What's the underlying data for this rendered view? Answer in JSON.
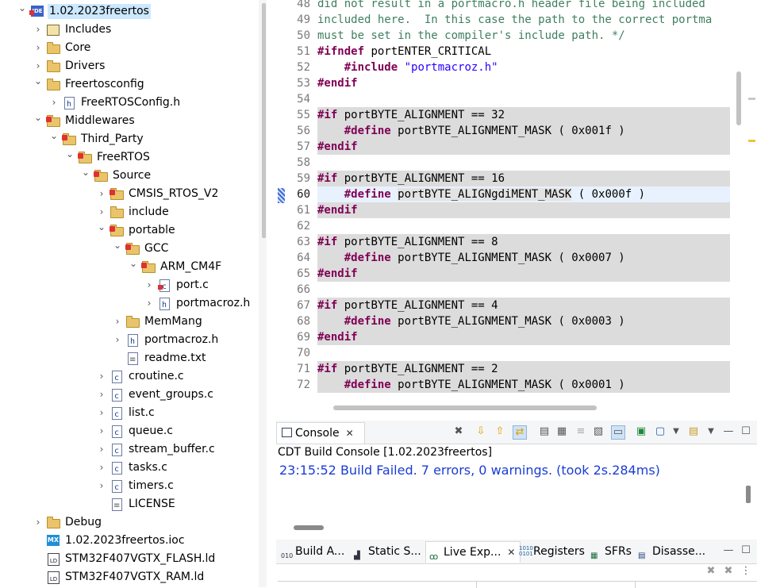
{
  "project_tree": [
    {
      "label": "1.02.2023freertos",
      "icon": "project-icon",
      "twisty": "expanded",
      "selected": true
    },
    {
      "label": "Includes",
      "icon": "includes-icon",
      "twisty": "collapsed"
    },
    {
      "label": "Core",
      "icon": "folder-icon",
      "twisty": "collapsed"
    },
    {
      "label": "Drivers",
      "icon": "folder-icon",
      "twisty": "collapsed"
    },
    {
      "label": "Freertosconfig",
      "icon": "folder-icon",
      "twisty": "expanded"
    },
    {
      "label": "FreeRTOSConfig.h",
      "icon": "header-file-icon",
      "twisty": "collapsed"
    },
    {
      "label": "Middlewares",
      "icon": "source-folder-icon",
      "twisty": "expanded"
    },
    {
      "label": "Third_Party",
      "icon": "source-folder-icon",
      "twisty": "expanded"
    },
    {
      "label": "FreeRTOS",
      "icon": "source-folder-icon",
      "twisty": "expanded"
    },
    {
      "label": "Source",
      "icon": "source-folder-icon",
      "twisty": "expanded"
    },
    {
      "label": "CMSIS_RTOS_V2",
      "icon": "source-folder-icon",
      "twisty": "collapsed"
    },
    {
      "label": "include",
      "icon": "folder-icon",
      "twisty": "collapsed"
    },
    {
      "label": "portable",
      "icon": "source-folder-icon",
      "twisty": "expanded"
    },
    {
      "label": "GCC",
      "icon": "source-folder-icon",
      "twisty": "expanded"
    },
    {
      "label": "ARM_CM4F",
      "icon": "source-folder-icon",
      "twisty": "expanded"
    },
    {
      "label": "port.c",
      "icon": "c-file-error-icon",
      "twisty": "collapsed"
    },
    {
      "label": "portmacroz.h",
      "icon": "header-file-icon",
      "twisty": "collapsed"
    },
    {
      "label": "MemMang",
      "icon": "folder-icon",
      "twisty": "collapsed"
    },
    {
      "label": "portmacroz.h",
      "icon": "header-file-icon",
      "twisty": "collapsed"
    },
    {
      "label": "readme.txt",
      "icon": "text-file-icon",
      "twisty": "none"
    },
    {
      "label": "croutine.c",
      "icon": "c-file-icon",
      "twisty": "collapsed"
    },
    {
      "label": "event_groups.c",
      "icon": "c-file-icon",
      "twisty": "collapsed"
    },
    {
      "label": "list.c",
      "icon": "c-file-icon",
      "twisty": "collapsed"
    },
    {
      "label": "queue.c",
      "icon": "c-file-icon",
      "twisty": "collapsed"
    },
    {
      "label": "stream_buffer.c",
      "icon": "c-file-icon",
      "twisty": "collapsed"
    },
    {
      "label": "tasks.c",
      "icon": "c-file-icon",
      "twisty": "collapsed"
    },
    {
      "label": "timers.c",
      "icon": "c-file-icon",
      "twisty": "collapsed"
    },
    {
      "label": "LICENSE",
      "icon": "text-file-icon",
      "twisty": "none"
    },
    {
      "label": "Debug",
      "icon": "folder-icon",
      "twisty": "collapsed"
    },
    {
      "label": "1.02.2023freertos.ioc",
      "icon": "ioc-file-icon",
      "twisty": "none"
    },
    {
      "label": "STM32F407VGTX_FLASH.ld",
      "icon": "linker-file-icon",
      "twisty": "none"
    },
    {
      "label": "STM32F407VGTX_RAM.ld",
      "icon": "linker-file-icon",
      "twisty": "none"
    }
  ],
  "editor": {
    "lines": [
      {
        "n": "48",
        "text": "did not result in a portmacro.h header file being included",
        "kind": "comment"
      },
      {
        "n": "49",
        "text": "included here.  In this case the path to the correct portma",
        "kind": "comment"
      },
      {
        "n": "50",
        "text": "must be set in the compiler's include path. */",
        "kind": "comment"
      },
      {
        "n": "51",
        "kw": "#ifndef",
        "rest": " portENTER_CRITICAL",
        "kind": "directive"
      },
      {
        "n": "52",
        "indent": "    ",
        "kw": "#include",
        "rest": " ",
        "str": "\"portmacroz.h\"",
        "kind": "directive"
      },
      {
        "n": "53",
        "kw": "#endif",
        "rest": "",
        "kind": "directive"
      },
      {
        "n": "54",
        "text": "",
        "kind": "blank"
      },
      {
        "n": "55",
        "kw": "#if",
        "rest": " portBYTE_ALIGNMENT == 32",
        "kind": "inactive"
      },
      {
        "n": "56",
        "indent": "    ",
        "kw": "#define",
        "rest": " portBYTE_ALIGNMENT_MASK ( 0x001f )",
        "kind": "inactive"
      },
      {
        "n": "57",
        "kw": "#endif",
        "rest": "",
        "kind": "inactive"
      },
      {
        "n": "58",
        "text": "",
        "kind": "blank"
      },
      {
        "n": "59",
        "kw": "#if",
        "rest": " portBYTE_ALIGNMENT == 16",
        "kind": "inactive"
      },
      {
        "n": "60",
        "indent": "    ",
        "kw": "#define",
        "rest": " ",
        "occ": "portBYTE_ALIGNgdiMENT_MASK",
        "rest2": " ( 0x000f )",
        "kind": "current"
      },
      {
        "n": "61",
        "kw": "#endif",
        "rest": "",
        "kind": "inactive"
      },
      {
        "n": "62",
        "text": "",
        "kind": "blank"
      },
      {
        "n": "63",
        "kw": "#if",
        "rest": " portBYTE_ALIGNMENT == 8",
        "kind": "inactive"
      },
      {
        "n": "64",
        "indent": "    ",
        "kw": "#define",
        "rest": " portBYTE_ALIGNMENT_MASK ( 0x0007 )",
        "kind": "inactive"
      },
      {
        "n": "65",
        "kw": "#endif",
        "rest": "",
        "kind": "inactive"
      },
      {
        "n": "66",
        "text": "",
        "kind": "blank"
      },
      {
        "n": "67",
        "kw": "#if",
        "rest": " portBYTE_ALIGNMENT == 4",
        "kind": "inactive"
      },
      {
        "n": "68",
        "indent": "    ",
        "kw": "#define",
        "rest": " portBYTE_ALIGNMENT_MASK ( 0x0003 )",
        "kind": "inactive"
      },
      {
        "n": "69",
        "kw": "#endif",
        "rest": "",
        "kind": "inactive"
      },
      {
        "n": "70",
        "text": "",
        "kind": "blank"
      },
      {
        "n": "71",
        "kw": "#if",
        "rest": " portBYTE_ALIGNMENT == 2",
        "kind": "inactive"
      },
      {
        "n": "72",
        "indent": "    ",
        "kw": "#define",
        "rest": " portBYTE_ALIGNMENT_MASK ( 0x0001 )",
        "kind": "inactive"
      }
    ]
  },
  "console": {
    "tab_label": "Console",
    "title": "CDT Build Console [1.02.2023freertos]",
    "output": "23:15:52 Build Failed. 7 errors, 0 warnings. (took 2s.284ms)",
    "toolbar_icons": [
      "clear-console-icon",
      "scroll-down-icon",
      "scroll-up-icon",
      "word-wrap-icon",
      "copy-icon",
      "pin-icon",
      "remove-icon",
      "remove-all-icon",
      "display-selected-icon",
      "open-console-icon",
      "open-console-dropdown-icon",
      "new-console-icon",
      "new-console-dropdown-icon",
      "minimize-icon",
      "maximize-icon"
    ]
  },
  "bottom_tabs": [
    {
      "label": "Build A...",
      "icon": "build-analyzer-icon"
    },
    {
      "label": "Static S...",
      "icon": "static-stack-icon"
    },
    {
      "label": "Live Exp...",
      "icon": "live-expressions-icon",
      "active": true
    },
    {
      "label": "Registers",
      "icon": "registers-icon"
    },
    {
      "label": "SFRs",
      "icon": "sfrs-icon"
    },
    {
      "label": "Disasse...",
      "icon": "disassembly-icon"
    }
  ],
  "colors": {
    "selection": "#cce8ff",
    "keyword": "#7f0055",
    "comment": "#3f7f5f",
    "string": "#2a00ff",
    "console_text": "#1a3cd6",
    "inactive_code": "#dcdcdc",
    "current_line": "#e8f2fe"
  }
}
